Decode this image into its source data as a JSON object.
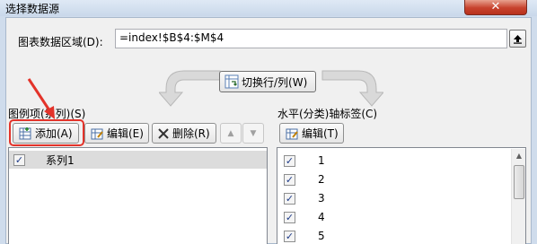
{
  "window": {
    "title": "选择数据源",
    "close_glyph": "✕"
  },
  "range": {
    "label": "图表数据区域(D):",
    "value": "=index!$B$4:$M$4"
  },
  "switch_button": {
    "label": "切换行/列(W)"
  },
  "legend": {
    "section_label": "图例项(系列)(S)",
    "add_label": "添加(A)",
    "edit_label": "编辑(E)",
    "delete_label": "删除(R)",
    "up_glyph": "▲",
    "down_glyph": "▼",
    "items": [
      {
        "label": "系列1",
        "checked": true
      }
    ]
  },
  "axis": {
    "section_label": "水平(分类)轴标签(C)",
    "edit_label": "编辑(T)",
    "items": [
      {
        "label": "1",
        "checked": true
      },
      {
        "label": "2",
        "checked": true
      },
      {
        "label": "3",
        "checked": true
      },
      {
        "label": "4",
        "checked": true
      },
      {
        "label": "5",
        "checked": true
      }
    ]
  },
  "colors": {
    "highlight": "#e3332a",
    "selection": "#dcdcdc",
    "checkmark": "#1f3c88"
  }
}
